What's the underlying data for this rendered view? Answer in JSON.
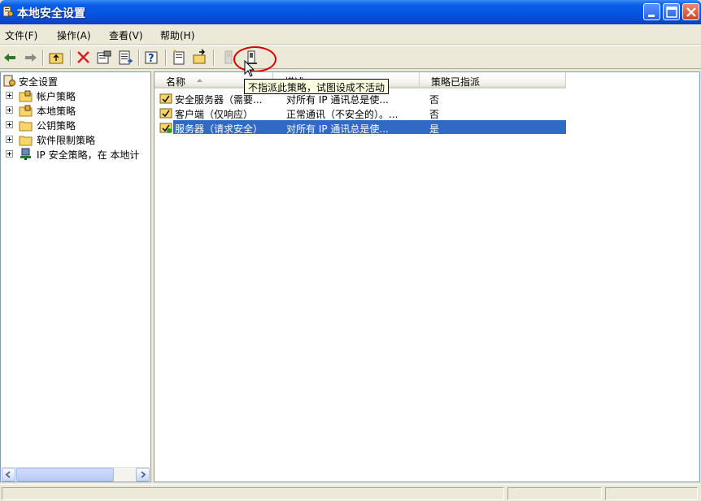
{
  "window": {
    "title": "本地安全设置"
  },
  "menubar": {
    "items": [
      {
        "label": "文件(F)"
      },
      {
        "label": "操作(A)"
      },
      {
        "label": "查看(V)"
      },
      {
        "label": "帮助(H)"
      }
    ]
  },
  "toolbar": {
    "buttons": [
      {
        "icon": "back-arrow-icon"
      },
      {
        "icon": "forward-arrow-icon"
      },
      {
        "icon": "up-folder-icon"
      },
      {
        "icon": "delete-x-icon"
      },
      {
        "icon": "properties-icon"
      },
      {
        "icon": "export-list-icon"
      },
      {
        "icon": "help-icon"
      },
      {
        "icon": "new-policy-icon"
      },
      {
        "icon": "manage-filters-icon"
      },
      {
        "icon": "assign-policy-icon"
      },
      {
        "icon": "unassign-policy-icon"
      }
    ]
  },
  "tree": {
    "root": "安全设置",
    "items": [
      {
        "label": "帐户策略"
      },
      {
        "label": "本地策略"
      },
      {
        "label": "公钥策略"
      },
      {
        "label": "软件限制策略"
      },
      {
        "label": "IP 安全策略，在 本地计"
      }
    ]
  },
  "list": {
    "columns": [
      {
        "label": "名称"
      },
      {
        "label": "描述"
      },
      {
        "label": "策略已指派"
      }
    ],
    "rows": [
      {
        "name": "安全服务器（需要...",
        "description": "对所有 IP 通讯总是使...",
        "assigned": "否",
        "selected": false
      },
      {
        "name": "客户端（仅响应）",
        "description": "正常通讯（不安全的）。...",
        "assigned": "否",
        "selected": false
      },
      {
        "name": "服务器（请求安全）",
        "description": "对所有 IP 通讯总是使...",
        "assigned": "是",
        "selected": true
      }
    ]
  },
  "tooltip": {
    "text": "不指派此策略，试图设成不活动"
  },
  "colors": {
    "titlebar": "#0553e0",
    "selection": "#316ac5",
    "tooltip_bg": "#ffffe1",
    "highlight_ring": "#d40000"
  }
}
